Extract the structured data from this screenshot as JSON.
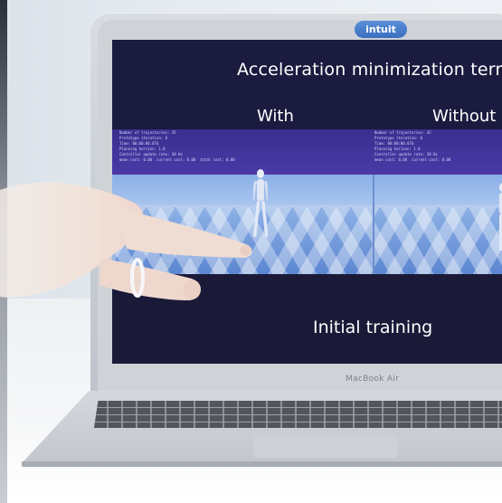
{
  "laptop": {
    "logo_text": "intuit",
    "brand_label": "MacBook Air"
  },
  "screen": {
    "title": "Acceleration minimization term",
    "left_label": "With",
    "right_label": "Without",
    "caption": "Initial training",
    "info_left": "Number of trajectories: 45\nPrototype iteration: 0\nTime: 00:00:00.076\nPlanning horizon: 1.0\nController update rate: 30 Hz\nmean cost: 0.00  current cost: 0.00  total cost: 0.00",
    "info_right": "Number of trajectories: 45\nPrototype iteration: 0\nTime: 00:00:00.076\nPlanning horizon: 1.0\nController update rate: 30 Hz\nmean cost: 0.00  current cost: 0.00"
  },
  "colors": {
    "screen_background": "#1a1a3a",
    "info_band": "#3a2f8f",
    "floor": "#5b86d1",
    "logo": "#4a7fcc"
  }
}
